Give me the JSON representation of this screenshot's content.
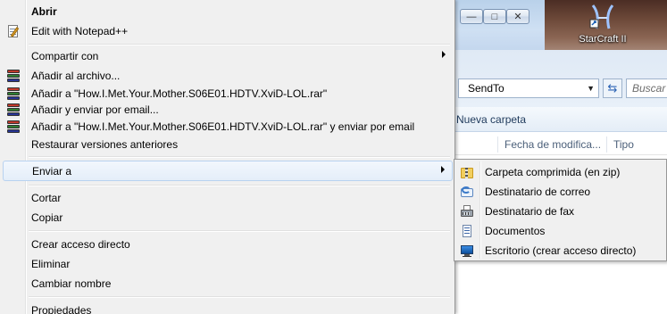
{
  "desktop": {
    "icon_label": "StarCraft II"
  },
  "explorer": {
    "address": "SendTo",
    "search_placeholder": "Buscar",
    "command": "Nueva carpeta",
    "columns": [
      "Fecha de modifica...",
      "Tipo"
    ]
  },
  "context_menu": {
    "items": [
      {
        "label": "Abrir",
        "icon": "none",
        "bold": true
      },
      {
        "label": "Edit with Notepad++",
        "icon": "notepad-icon"
      },
      {
        "label": "Compartir con",
        "submenu": true
      },
      {
        "label": "Añadir al archivo...",
        "icon": "winrar-icon"
      },
      {
        "label": "Añadir a \"How.I.Met.Your.Mother.S06E01.HDTV.XviD-LOL.rar\"",
        "icon": "winrar-icon"
      },
      {
        "label": "Añadir y enviar por email...",
        "icon": "winrar-icon"
      },
      {
        "label": "Añadir a \"How.I.Met.Your.Mother.S06E01.HDTV.XviD-LOL.rar\" y enviar por email",
        "icon": "winrar-icon"
      },
      {
        "label": "Restaurar versiones anteriores"
      },
      {
        "label": "Enviar a",
        "submenu": true,
        "highlighted": true
      },
      {
        "label": "Cortar"
      },
      {
        "label": "Copiar"
      },
      {
        "label": "Crear acceso directo"
      },
      {
        "label": "Eliminar"
      },
      {
        "label": "Cambiar nombre"
      },
      {
        "label": "Propiedades"
      }
    ]
  },
  "send_to_menu": {
    "items": [
      {
        "label": "Carpeta comprimida (en zip)",
        "icon": "zip-folder-icon"
      },
      {
        "label": "Destinatario de correo",
        "icon": "mail-recipient-icon"
      },
      {
        "label": "Destinatario de fax",
        "icon": "fax-icon"
      },
      {
        "label": "Documentos",
        "icon": "documents-icon"
      },
      {
        "label": "Escritorio (crear acceso directo)",
        "icon": "desktop-icon"
      }
    ]
  }
}
